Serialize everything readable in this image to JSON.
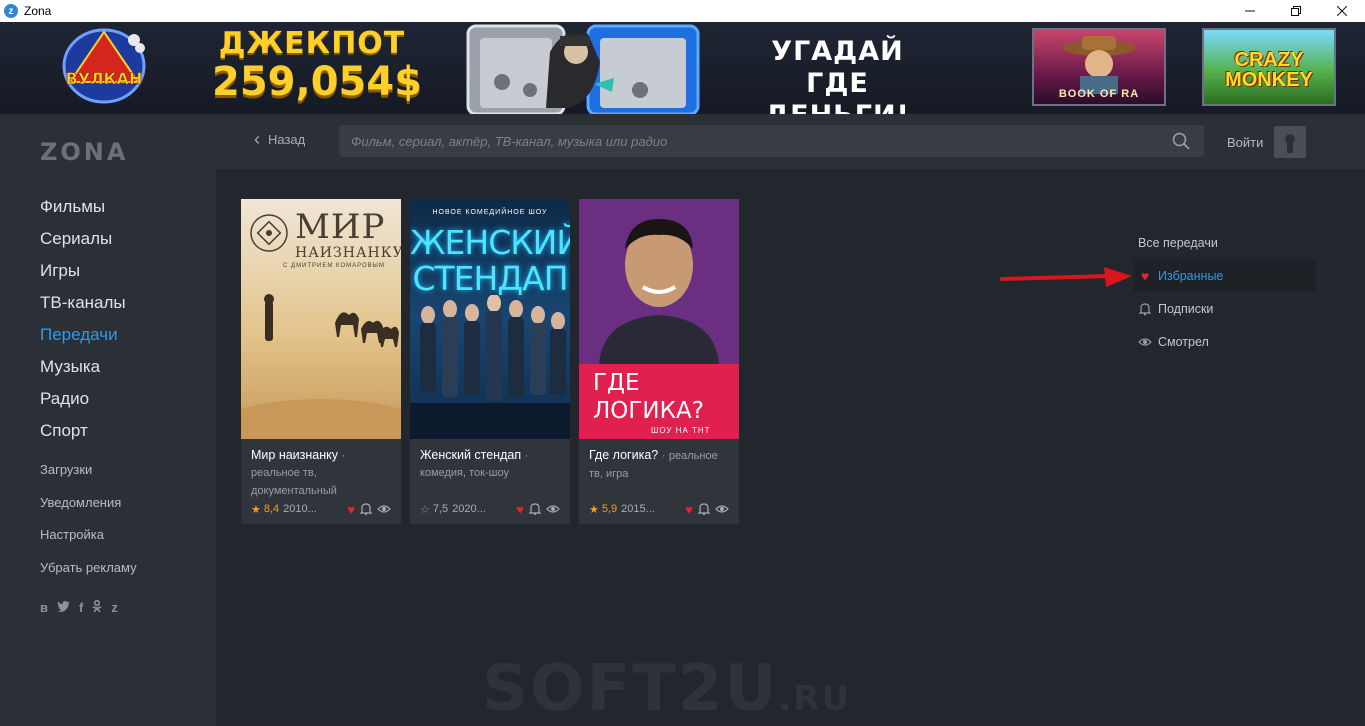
{
  "window": {
    "title": "Zona",
    "app_icon": "zona-icon",
    "controls": [
      "minimize",
      "restore",
      "close"
    ]
  },
  "banner": {
    "brand": "ВУЛКАН",
    "jackpot_line1": "ДЖЕКПОТ",
    "jackpot_line2": "259,054$",
    "guess_line1": "УГАДАЙ",
    "guess_line2": "ГДЕ ДЕНЬГИ!",
    "game1": "BOOK OF RA",
    "game2_line1": "CRAZY",
    "game2_line2": "MONKEY"
  },
  "sidebar": {
    "logo": "ZONA",
    "nav": [
      {
        "label": "Фильмы",
        "active": false
      },
      {
        "label": "Сериалы",
        "active": false
      },
      {
        "label": "Игры",
        "active": false
      },
      {
        "label": "ТВ-каналы",
        "active": false
      },
      {
        "label": "Передачи",
        "active": true
      },
      {
        "label": "Музыка",
        "active": false
      },
      {
        "label": "Радио",
        "active": false
      },
      {
        "label": "Спорт",
        "active": false
      }
    ],
    "subnav": [
      {
        "label": "Загрузки"
      },
      {
        "label": "Уведомления"
      },
      {
        "label": "Настройка"
      },
      {
        "label": "Убрать рекламу"
      }
    ],
    "socials": [
      "vk-icon",
      "twitter-icon",
      "facebook-icon",
      "odnoklassniki-icon",
      "zona-icon"
    ]
  },
  "topbar": {
    "back_label": "Назад",
    "search_placeholder": "Фильм, сериал, актёр, ТВ-канал, музыка или радио",
    "login_label": "Войти"
  },
  "cards": [
    {
      "title": "Мир наизнанку",
      "genre": "реальное тв, документальный",
      "rating": "8,4",
      "year": "2010...",
      "poster_title": "МИР",
      "poster_subtitle": "НАИЗНАНКУ",
      "poster_subtitle2": "С ДМИТРИЕМ КОМАРОВЫМ"
    },
    {
      "title": "Женский стендап",
      "genre": "комедия, ток-шоу",
      "rating": "7,5",
      "year": "2020...",
      "poster_tag": "НОВОЕ КОМЕДИЙНОЕ ШОУ",
      "poster_title_line1": "ЖЕНСКИЙ",
      "poster_title_line2": "СТЕНДАП"
    },
    {
      "title": "Где логика?",
      "genre": "реальное тв, игра",
      "rating": "5,9",
      "year": "2015...",
      "poster_title_line1": "ГДЕ",
      "poster_title_line2": "ЛОГИКА?",
      "poster_subtitle": "ШОУ НА ТНТ"
    }
  ],
  "filters": {
    "items": [
      {
        "label": "Все передачи",
        "icon": "",
        "active": false
      },
      {
        "label": "Избранные",
        "icon": "heart-icon",
        "active": true
      },
      {
        "label": "Подписки",
        "icon": "bell-icon",
        "active": false
      },
      {
        "label": "Смотрел",
        "icon": "eye-icon",
        "active": false
      }
    ]
  },
  "watermark": {
    "main": "SOFT2U",
    "suffix": ".RU"
  },
  "colors": {
    "accent": "#2f9ae8",
    "heart": "#e3262c",
    "rating": "#f0a020",
    "background": "#22262d",
    "sidebar": "#2b2f36"
  }
}
